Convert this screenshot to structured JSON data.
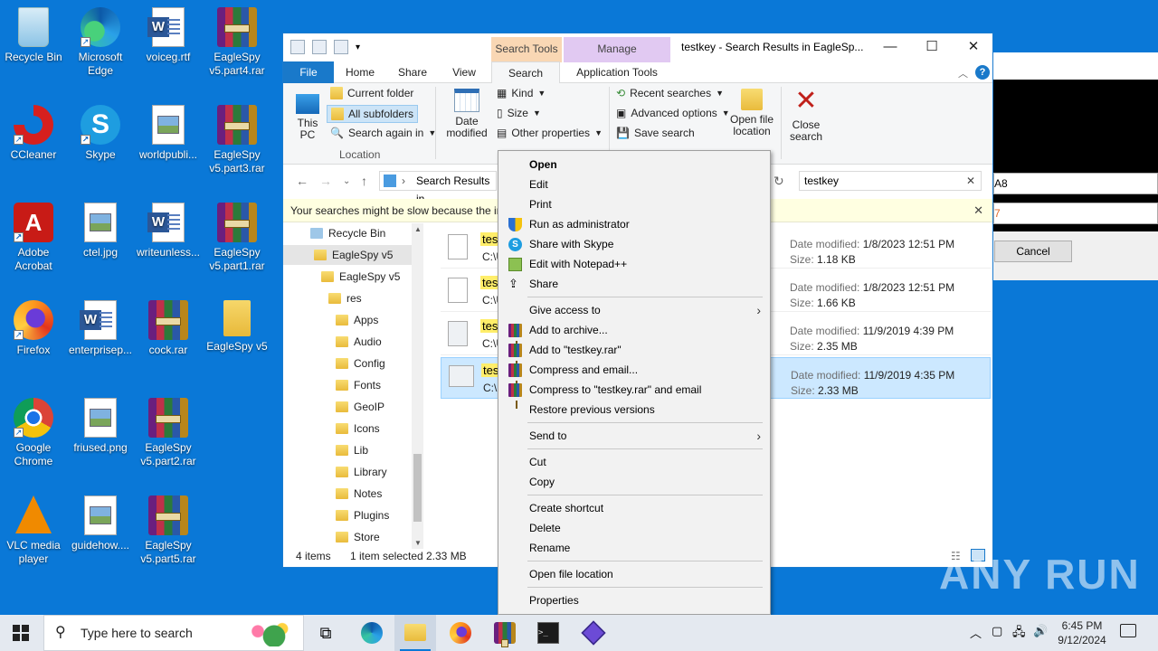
{
  "desktop": {
    "icons": [
      {
        "label": "Recycle Bin",
        "icon": "recycle-bin-icon"
      },
      {
        "label": "Microsoft Edge",
        "icon": "edge-icon"
      },
      {
        "label": "voiceg.rtf",
        "icon": "word-document-icon"
      },
      {
        "label": "EagleSpy v5.part4.rar",
        "icon": "winrar-archive-icon"
      },
      {
        "label": "CCleaner",
        "icon": "ccleaner-icon"
      },
      {
        "label": "Skype",
        "icon": "skype-icon"
      },
      {
        "label": "worldpubli...",
        "icon": "image-file-icon"
      },
      {
        "label": "EagleSpy v5.part3.rar",
        "icon": "winrar-archive-icon"
      },
      {
        "label": "Adobe Acrobat",
        "icon": "acrobat-icon"
      },
      {
        "label": "ctel.jpg",
        "icon": "image-file-icon"
      },
      {
        "label": "writeunless...",
        "icon": "word-document-icon"
      },
      {
        "label": "EagleSpy v5.part1.rar",
        "icon": "winrar-archive-icon"
      },
      {
        "label": "Firefox",
        "icon": "firefox-icon"
      },
      {
        "label": "enterprisep...",
        "icon": "word-document-icon"
      },
      {
        "label": "cock.rar",
        "icon": "winrar-archive-icon"
      },
      {
        "label": "EagleSpy v5",
        "icon": "folder-icon"
      },
      {
        "label": "Google Chrome",
        "icon": "chrome-icon"
      },
      {
        "label": "friused.png",
        "icon": "image-file-icon"
      },
      {
        "label": "EagleSpy v5.part2.rar",
        "icon": "winrar-archive-icon"
      },
      {
        "label": "VLC media player",
        "icon": "vlc-icon"
      },
      {
        "label": "guidehow....",
        "icon": "image-file-icon"
      },
      {
        "label": "EagleSpy v5.part5.rar",
        "icon": "winrar-archive-icon"
      }
    ]
  },
  "explorer": {
    "title": "testkey - Search Results in EagleSp...",
    "contextual_tabs": {
      "search_tools": "Search Tools",
      "manage": "Manage"
    },
    "tabs": {
      "file": "File",
      "home": "Home",
      "share": "Share",
      "view": "View",
      "search": "Search",
      "application_tools": "Application Tools"
    },
    "ribbon": {
      "this_pc": "This PC",
      "current_folder": "Current folder",
      "all_subfolders": "All subfolders",
      "search_again_in": "Search again in",
      "location_group": "Location",
      "date_modified": "Date modified",
      "kind": "Kind",
      "size": "Size",
      "other_properties": "Other properties",
      "recent_searches": "Recent searches",
      "advanced_options": "Advanced options",
      "save_search": "Save search",
      "open_file_location": "Open file location",
      "close_search": "Close search"
    },
    "address": "Search Results in",
    "search_value": "testkey",
    "infobar_text": "Your searches might be slow because the in",
    "nav_tree": [
      {
        "label": "Recycle Bin"
      },
      {
        "label": "EagleSpy v5"
      },
      {
        "label": "EagleSpy v5"
      },
      {
        "label": "res"
      },
      {
        "label": "Apps"
      },
      {
        "label": "Audio"
      },
      {
        "label": "Config"
      },
      {
        "label": "Fonts"
      },
      {
        "label": "GeoIP"
      },
      {
        "label": "Icons"
      },
      {
        "label": "Lib"
      },
      {
        "label": "Library"
      },
      {
        "label": "Notes"
      },
      {
        "label": "Plugins"
      },
      {
        "label": "Store"
      }
    ],
    "files": [
      {
        "name": "tes",
        "path": "C:\\U",
        "date_label": "Date modified:",
        "date": "1/8/2023 12:51 PM",
        "size_label": "Size:",
        "size": "1.18 KB"
      },
      {
        "name": "tes",
        "path": "C:\\U",
        "date_label": "Date modified:",
        "date": "1/8/2023 12:51 PM",
        "size_label": "Size:",
        "size": "1.66 KB"
      },
      {
        "name": "tes",
        "path": "C:\\U",
        "date_label": "Date modified:",
        "date": "11/9/2019 4:39 PM",
        "size_label": "Size:",
        "size": "2.35 MB"
      },
      {
        "name": "tes",
        "path": "C:\\U",
        "date_label": "Date modified:",
        "date": "11/9/2019 4:35 PM",
        "size_label": "Size:",
        "size": "2.33 MB"
      }
    ],
    "status": {
      "items": "4 items",
      "selected": "1 item selected",
      "selected_size": "2.33 MB"
    }
  },
  "background_dialog": {
    "field_value": "A8",
    "field_value2": "7",
    "cancel": "Cancel"
  },
  "context_menu": {
    "items": [
      {
        "label": "Open"
      },
      {
        "label": "Edit"
      },
      {
        "label": "Print"
      },
      {
        "label": "Run as administrator"
      },
      {
        "label": "Share with Skype"
      },
      {
        "label": "Edit with Notepad++"
      },
      {
        "label": "Share"
      },
      {
        "label": "Give access to"
      },
      {
        "label": "Add to archive..."
      },
      {
        "label": "Add to \"testkey.rar\""
      },
      {
        "label": "Compress and email..."
      },
      {
        "label": "Compress to \"testkey.rar\" and email"
      },
      {
        "label": "Restore previous versions"
      },
      {
        "label": "Send to"
      },
      {
        "label": "Cut"
      },
      {
        "label": "Copy"
      },
      {
        "label": "Create shortcut"
      },
      {
        "label": "Delete"
      },
      {
        "label": "Rename"
      },
      {
        "label": "Open file location"
      },
      {
        "label": "Properties"
      }
    ]
  },
  "taskbar": {
    "search_placeholder": "Type here to search",
    "time": "6:45 PM",
    "date": "9/12/2024"
  },
  "watermark": "ANY RUN"
}
